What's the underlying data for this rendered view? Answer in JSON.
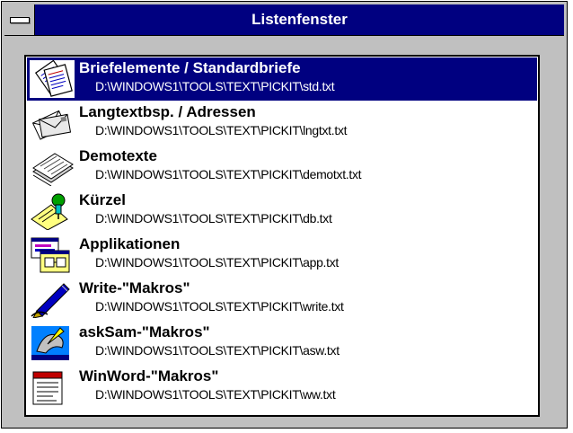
{
  "window": {
    "title": "Listenfenster"
  },
  "list": {
    "items": [
      {
        "name": "Briefelemente / Standardbriefe",
        "path": "D:\\WINDOWS1\\TOOLS\\TEXT\\PICKIT\\std.txt",
        "icon": "letters-icon",
        "selected": true
      },
      {
        "name": "Langtextbsp. / Adressen",
        "path": "D:\\WINDOWS1\\TOOLS\\TEXT\\PICKIT\\lngtxt.txt",
        "icon": "envelopes-icon",
        "selected": false
      },
      {
        "name": "Demotexte",
        "path": "D:\\WINDOWS1\\TOOLS\\TEXT\\PICKIT\\demotxt.txt",
        "icon": "newspaper-stack-icon",
        "selected": false
      },
      {
        "name": "Kürzel",
        "path": "D:\\WINDOWS1\\TOOLS\\TEXT\\PICKIT\\db.txt",
        "icon": "notepad-pin-icon",
        "selected": false
      },
      {
        "name": "Applikationen",
        "path": "D:\\WINDOWS1\\TOOLS\\TEXT\\PICKIT\\app.txt",
        "icon": "applications-icon",
        "selected": false
      },
      {
        "name": "Write-\"Makros\"",
        "path": "D:\\WINDOWS1\\TOOLS\\TEXT\\PICKIT\\write.txt",
        "icon": "pen-icon",
        "selected": false
      },
      {
        "name": "askSam-\"Makros\"",
        "path": "D:\\WINDOWS1\\TOOLS\\TEXT\\PICKIT\\asw.txt",
        "icon": "asksam-icon",
        "selected": false
      },
      {
        "name": "WinWord-\"Makros\"",
        "path": "D:\\WINDOWS1\\TOOLS\\TEXT\\PICKIT\\ww.txt",
        "icon": "winword-document-icon",
        "selected": false
      }
    ]
  },
  "colors": {
    "titlebar": "#000080",
    "selection": "#000080",
    "frame": "#c0c0c0"
  }
}
